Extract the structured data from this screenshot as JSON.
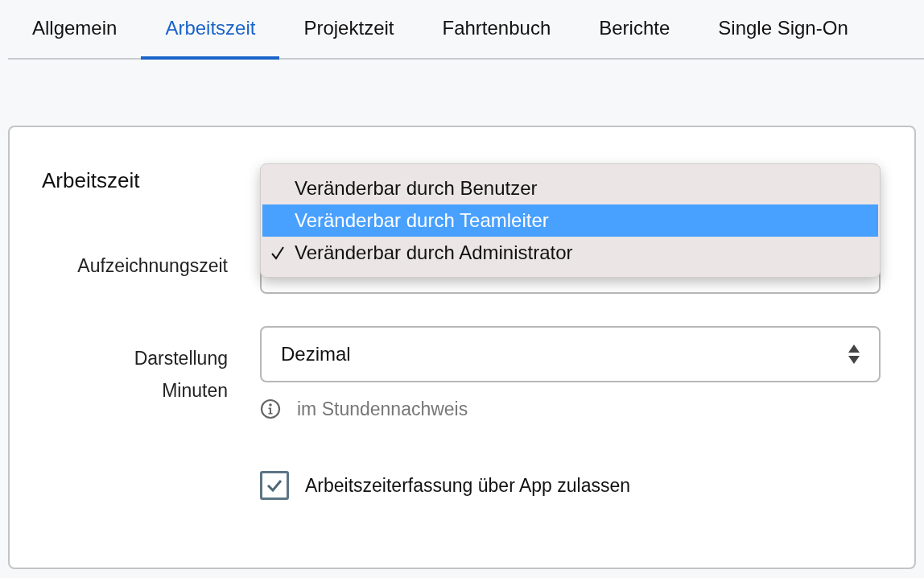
{
  "tabs": [
    {
      "label": "Allgemein",
      "selected": false
    },
    {
      "label": "Arbeitszeit",
      "selected": true
    },
    {
      "label": "Projektzeit",
      "selected": false
    },
    {
      "label": "Fahrtenbuch",
      "selected": false
    },
    {
      "label": "Berichte",
      "selected": false
    },
    {
      "label": "Single Sign-On",
      "selected": false
    }
  ],
  "card": {
    "title": "Arbeitszeit",
    "fields": [
      {
        "kind": "open-select",
        "label": "Aufzeichnungszeit",
        "options": [
          {
            "label": "Veränderbar durch Benutzer",
            "selected": false,
            "checked": false
          },
          {
            "label": "Veränderbar durch Teamleiter",
            "selected": true,
            "checked": false
          },
          {
            "label": "Veränderbar durch Administrator",
            "selected": false,
            "checked": true
          }
        ]
      },
      {
        "kind": "select",
        "label": "Darstellung Minuten",
        "value": "Dezimal",
        "hint": "im Stundennachweis"
      }
    ],
    "checkbox": {
      "label": "Arbeitszeiterfassung über App zulassen",
      "checked": true
    }
  }
}
